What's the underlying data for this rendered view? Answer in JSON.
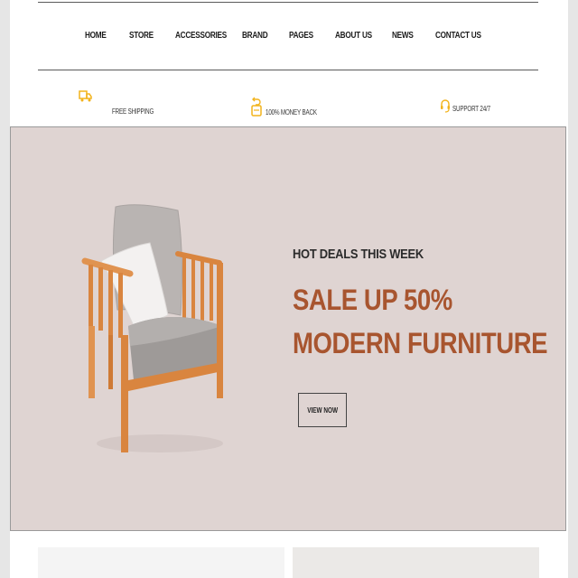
{
  "nav": {
    "items": [
      {
        "label": "HOME"
      },
      {
        "label": "STORE"
      },
      {
        "label": "ACCESSORIES"
      },
      {
        "label": "BRAND"
      },
      {
        "label": "PAGES"
      },
      {
        "label": "ABOUT US"
      },
      {
        "label": "NEWS"
      },
      {
        "label": "CONTACT US"
      }
    ]
  },
  "features": [
    {
      "icon": "truck-icon",
      "label": "FREE SHIPPING"
    },
    {
      "icon": "money-back-icon",
      "label": "100% MONEY BACK"
    },
    {
      "icon": "headset-icon",
      "label": "SUPPORT 24/7"
    }
  ],
  "hero": {
    "kicker": "HOT DEALS THIS WEEK",
    "headline_line1": "SALE UP 50%",
    "headline_line2": "MODERN FURNITURE",
    "cta_label": "VIEW NOW",
    "image": "armchair-image"
  },
  "colors": {
    "accent": "#a8552f",
    "icon": "#f2b31b",
    "hero_bg": "#dfd4d2"
  }
}
